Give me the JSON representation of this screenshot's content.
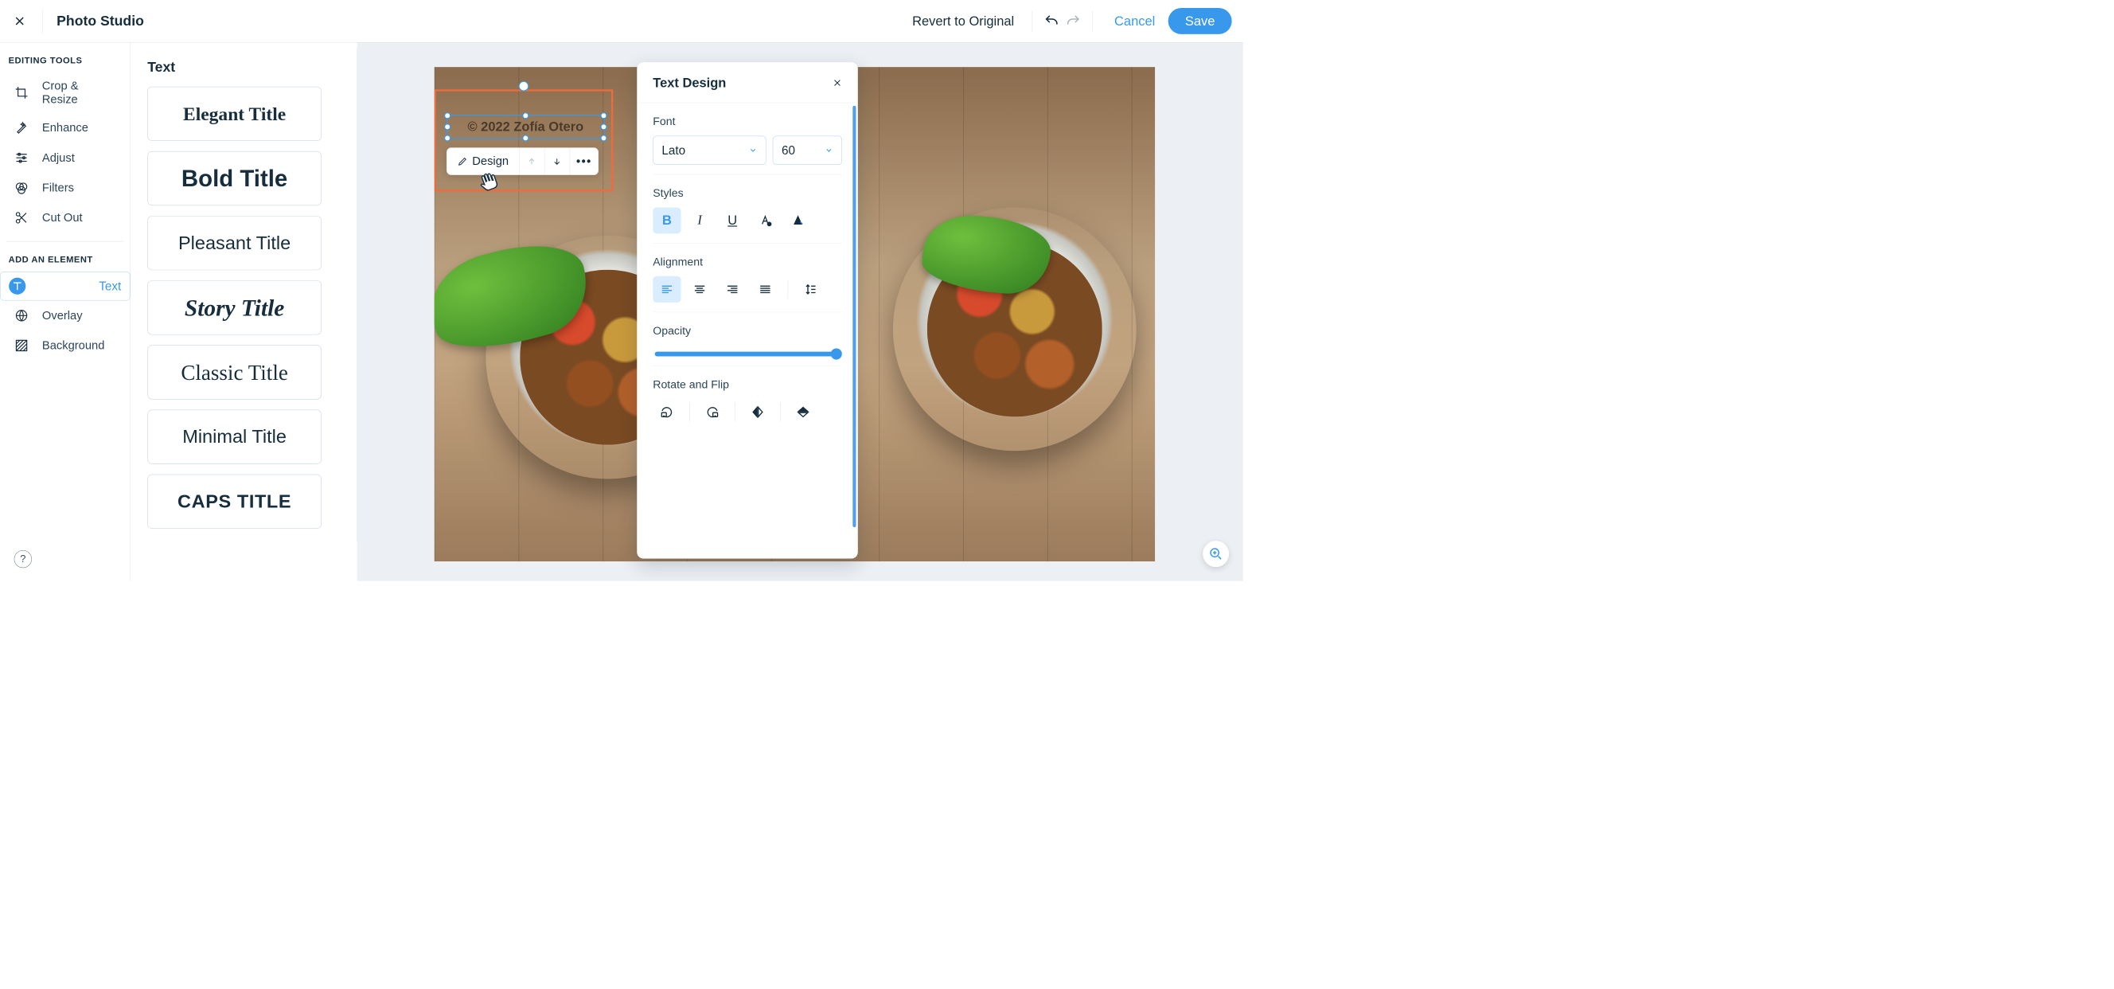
{
  "header": {
    "title": "Photo Studio",
    "revert": "Revert to Original",
    "cancel": "Cancel",
    "save": "Save"
  },
  "sidebar": {
    "editing_label": "EDITING TOOLS",
    "add_label": "ADD AN ELEMENT",
    "editing": [
      {
        "label": "Crop & Resize"
      },
      {
        "label": "Enhance"
      },
      {
        "label": "Adjust"
      },
      {
        "label": "Filters"
      },
      {
        "label": "Cut Out"
      }
    ],
    "add": [
      {
        "label": "Text"
      },
      {
        "label": "Overlay"
      },
      {
        "label": "Background"
      }
    ]
  },
  "presets": {
    "heading": "Text",
    "items": [
      "Elegant Title",
      "Bold Title",
      "Pleasant Title",
      "Story Title",
      "Classic Title",
      "Minimal Title",
      "CAPS TITLE"
    ]
  },
  "canvas": {
    "text_value": "© 2022 Zofía Otero",
    "context": {
      "design": "Design"
    }
  },
  "design": {
    "title": "Text Design",
    "font_label": "Font",
    "font_family": "Lato",
    "font_size": "60",
    "styles_label": "Styles",
    "alignment_label": "Alignment",
    "opacity_label": "Opacity",
    "rotate_label": "Rotate and Flip",
    "opacity_value": 100
  }
}
